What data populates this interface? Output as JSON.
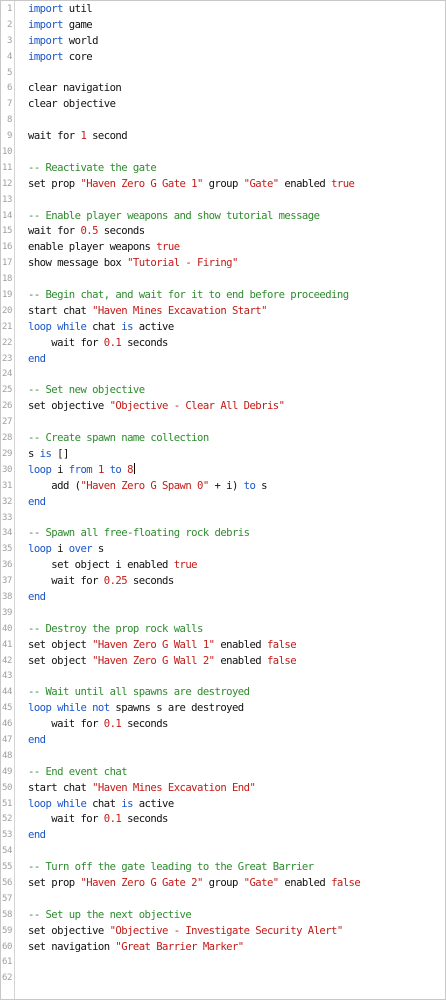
{
  "editor": {
    "lines": [
      {
        "n": "1",
        "tokens": [
          {
            "t": "keyword",
            "v": "import"
          },
          {
            "t": "plain",
            "v": " util"
          }
        ]
      },
      {
        "n": "2",
        "tokens": [
          {
            "t": "keyword",
            "v": "import"
          },
          {
            "t": "plain",
            "v": " game"
          }
        ]
      },
      {
        "n": "3",
        "tokens": [
          {
            "t": "keyword",
            "v": "import"
          },
          {
            "t": "plain",
            "v": " world"
          }
        ]
      },
      {
        "n": "4",
        "tokens": [
          {
            "t": "keyword",
            "v": "import"
          },
          {
            "t": "plain",
            "v": " core"
          }
        ]
      },
      {
        "n": "5",
        "tokens": []
      },
      {
        "n": "6",
        "tokens": [
          {
            "t": "plain",
            "v": "clear navigation"
          }
        ]
      },
      {
        "n": "7",
        "tokens": [
          {
            "t": "plain",
            "v": "clear objective"
          }
        ]
      },
      {
        "n": "8",
        "tokens": []
      },
      {
        "n": "9",
        "tokens": [
          {
            "t": "plain",
            "v": "wait for "
          },
          {
            "t": "number",
            "v": "1"
          },
          {
            "t": "plain",
            "v": " second"
          }
        ]
      },
      {
        "n": "10",
        "tokens": []
      },
      {
        "n": "11",
        "tokens": [
          {
            "t": "comment",
            "v": "-- Reactivate the gate"
          }
        ]
      },
      {
        "n": "12",
        "tokens": [
          {
            "t": "plain",
            "v": "set prop "
          },
          {
            "t": "string",
            "v": "\"Haven Zero G Gate 1\""
          },
          {
            "t": "plain",
            "v": " group "
          },
          {
            "t": "string",
            "v": "\"Gate\""
          },
          {
            "t": "plain",
            "v": " enabled "
          },
          {
            "t": "boolean",
            "v": "true"
          }
        ]
      },
      {
        "n": "13",
        "tokens": []
      },
      {
        "n": "14",
        "tokens": [
          {
            "t": "comment",
            "v": "-- Enable player weapons and show tutorial message"
          }
        ]
      },
      {
        "n": "15",
        "tokens": [
          {
            "t": "plain",
            "v": "wait for "
          },
          {
            "t": "number",
            "v": "0.5"
          },
          {
            "t": "plain",
            "v": " seconds"
          }
        ]
      },
      {
        "n": "16",
        "tokens": [
          {
            "t": "plain",
            "v": "enable player weapons "
          },
          {
            "t": "boolean",
            "v": "true"
          }
        ]
      },
      {
        "n": "17",
        "tokens": [
          {
            "t": "plain",
            "v": "show message box "
          },
          {
            "t": "string",
            "v": "\"Tutorial - Firing\""
          }
        ]
      },
      {
        "n": "18",
        "tokens": []
      },
      {
        "n": "19",
        "tokens": [
          {
            "t": "comment",
            "v": "-- Begin chat, and wait for it to end before proceeding"
          }
        ]
      },
      {
        "n": "20",
        "tokens": [
          {
            "t": "plain",
            "v": "start chat "
          },
          {
            "t": "string",
            "v": "\"Haven Mines Excavation Start\""
          }
        ]
      },
      {
        "n": "21",
        "tokens": [
          {
            "t": "keyword",
            "v": "loop while"
          },
          {
            "t": "plain",
            "v": " chat "
          },
          {
            "t": "keyword",
            "v": "is"
          },
          {
            "t": "plain",
            "v": " active"
          }
        ]
      },
      {
        "n": "22",
        "tokens": [
          {
            "t": "plain",
            "v": "    wait for "
          },
          {
            "t": "number",
            "v": "0.1"
          },
          {
            "t": "plain",
            "v": " seconds"
          }
        ]
      },
      {
        "n": "23",
        "tokens": [
          {
            "t": "keyword",
            "v": "end"
          }
        ]
      },
      {
        "n": "24",
        "tokens": []
      },
      {
        "n": "25",
        "tokens": [
          {
            "t": "comment",
            "v": "-- Set new objective"
          }
        ]
      },
      {
        "n": "26",
        "tokens": [
          {
            "t": "plain",
            "v": "set objective "
          },
          {
            "t": "string",
            "v": "\"Objective - Clear All Debris\""
          }
        ]
      },
      {
        "n": "27",
        "tokens": []
      },
      {
        "n": "28",
        "tokens": [
          {
            "t": "comment",
            "v": "-- Create spawn name collection"
          }
        ]
      },
      {
        "n": "29",
        "tokens": [
          {
            "t": "plain",
            "v": "s "
          },
          {
            "t": "keyword",
            "v": "is"
          },
          {
            "t": "plain",
            "v": " []"
          }
        ]
      },
      {
        "n": "30",
        "tokens": [
          {
            "t": "keyword",
            "v": "loop"
          },
          {
            "t": "plain",
            "v": " i "
          },
          {
            "t": "keyword",
            "v": "from"
          },
          {
            "t": "plain",
            "v": " "
          },
          {
            "t": "number",
            "v": "1"
          },
          {
            "t": "plain",
            "v": " "
          },
          {
            "t": "keyword",
            "v": "to"
          },
          {
            "t": "plain",
            "v": " "
          },
          {
            "t": "number",
            "v": "8"
          },
          {
            "t": "caret",
            "v": ""
          }
        ]
      },
      {
        "n": "31",
        "tokens": [
          {
            "t": "plain",
            "v": "    add ("
          },
          {
            "t": "string",
            "v": "\"Haven Zero G Spawn 0\""
          },
          {
            "t": "plain",
            "v": " + i) "
          },
          {
            "t": "keyword",
            "v": "to"
          },
          {
            "t": "plain",
            "v": " s"
          }
        ]
      },
      {
        "n": "32",
        "tokens": [
          {
            "t": "keyword",
            "v": "end"
          }
        ]
      },
      {
        "n": "33",
        "tokens": []
      },
      {
        "n": "34",
        "tokens": [
          {
            "t": "comment",
            "v": "-- Spawn all free-floating rock debris"
          }
        ]
      },
      {
        "n": "35",
        "tokens": [
          {
            "t": "keyword",
            "v": "loop"
          },
          {
            "t": "plain",
            "v": " i "
          },
          {
            "t": "keyword",
            "v": "over"
          },
          {
            "t": "plain",
            "v": " s"
          }
        ]
      },
      {
        "n": "36",
        "tokens": [
          {
            "t": "plain",
            "v": "    set object i enabled "
          },
          {
            "t": "boolean",
            "v": "true"
          }
        ]
      },
      {
        "n": "37",
        "tokens": [
          {
            "t": "plain",
            "v": "    wait for "
          },
          {
            "t": "number",
            "v": "0.25"
          },
          {
            "t": "plain",
            "v": " seconds"
          }
        ]
      },
      {
        "n": "38",
        "tokens": [
          {
            "t": "keyword",
            "v": "end"
          }
        ]
      },
      {
        "n": "39",
        "tokens": []
      },
      {
        "n": "40",
        "tokens": [
          {
            "t": "comment",
            "v": "-- Destroy the prop rock walls"
          }
        ]
      },
      {
        "n": "41",
        "tokens": [
          {
            "t": "plain",
            "v": "set object "
          },
          {
            "t": "string",
            "v": "\"Haven Zero G Wall 1\""
          },
          {
            "t": "plain",
            "v": " enabled "
          },
          {
            "t": "boolean",
            "v": "false"
          }
        ]
      },
      {
        "n": "42",
        "tokens": [
          {
            "t": "plain",
            "v": "set object "
          },
          {
            "t": "string",
            "v": "\"Haven Zero G Wall 2\""
          },
          {
            "t": "plain",
            "v": " enabled "
          },
          {
            "t": "boolean",
            "v": "false"
          }
        ]
      },
      {
        "n": "43",
        "tokens": []
      },
      {
        "n": "44",
        "tokens": [
          {
            "t": "comment",
            "v": "-- Wait until all spawns are destroyed"
          }
        ]
      },
      {
        "n": "45",
        "tokens": [
          {
            "t": "keyword",
            "v": "loop while not"
          },
          {
            "t": "plain",
            "v": " spawns s are destroyed"
          }
        ]
      },
      {
        "n": "46",
        "tokens": [
          {
            "t": "plain",
            "v": "    wait for "
          },
          {
            "t": "number",
            "v": "0.1"
          },
          {
            "t": "plain",
            "v": " seconds"
          }
        ]
      },
      {
        "n": "47",
        "tokens": [
          {
            "t": "keyword",
            "v": "end"
          }
        ]
      },
      {
        "n": "48",
        "tokens": []
      },
      {
        "n": "49",
        "tokens": [
          {
            "t": "comment",
            "v": "-- End event chat"
          }
        ]
      },
      {
        "n": "50",
        "tokens": [
          {
            "t": "plain",
            "v": "start chat "
          },
          {
            "t": "string",
            "v": "\"Haven Mines Excavation End\""
          }
        ]
      },
      {
        "n": "51",
        "tokens": [
          {
            "t": "keyword",
            "v": "loop while"
          },
          {
            "t": "plain",
            "v": " chat "
          },
          {
            "t": "keyword",
            "v": "is"
          },
          {
            "t": "plain",
            "v": " active"
          }
        ]
      },
      {
        "n": "52",
        "tokens": [
          {
            "t": "plain",
            "v": "    wait for "
          },
          {
            "t": "number",
            "v": "0.1"
          },
          {
            "t": "plain",
            "v": " seconds"
          }
        ]
      },
      {
        "n": "53",
        "tokens": [
          {
            "t": "keyword",
            "v": "end"
          }
        ]
      },
      {
        "n": "54",
        "tokens": []
      },
      {
        "n": "55",
        "tokens": [
          {
            "t": "comment",
            "v": "-- Turn off the gate leading to the Great Barrier"
          }
        ]
      },
      {
        "n": "56",
        "tokens": [
          {
            "t": "plain",
            "v": "set prop "
          },
          {
            "t": "string",
            "v": "\"Haven Zero G Gate 2\""
          },
          {
            "t": "plain",
            "v": " group "
          },
          {
            "t": "string",
            "v": "\"Gate\""
          },
          {
            "t": "plain",
            "v": " enabled "
          },
          {
            "t": "boolean",
            "v": "false"
          }
        ]
      },
      {
        "n": "57",
        "tokens": []
      },
      {
        "n": "58",
        "tokens": [
          {
            "t": "comment",
            "v": "-- Set up the next objective"
          }
        ]
      },
      {
        "n": "59",
        "tokens": [
          {
            "t": "plain",
            "v": "set objective "
          },
          {
            "t": "string",
            "v": "\"Objective - Investigate Security Alert\""
          }
        ]
      },
      {
        "n": "60",
        "tokens": [
          {
            "t": "plain",
            "v": "set navigation "
          },
          {
            "t": "string",
            "v": "\"Great Barrier Marker\""
          }
        ]
      },
      {
        "n": "61",
        "tokens": []
      },
      {
        "n": "62",
        "tokens": []
      }
    ]
  }
}
